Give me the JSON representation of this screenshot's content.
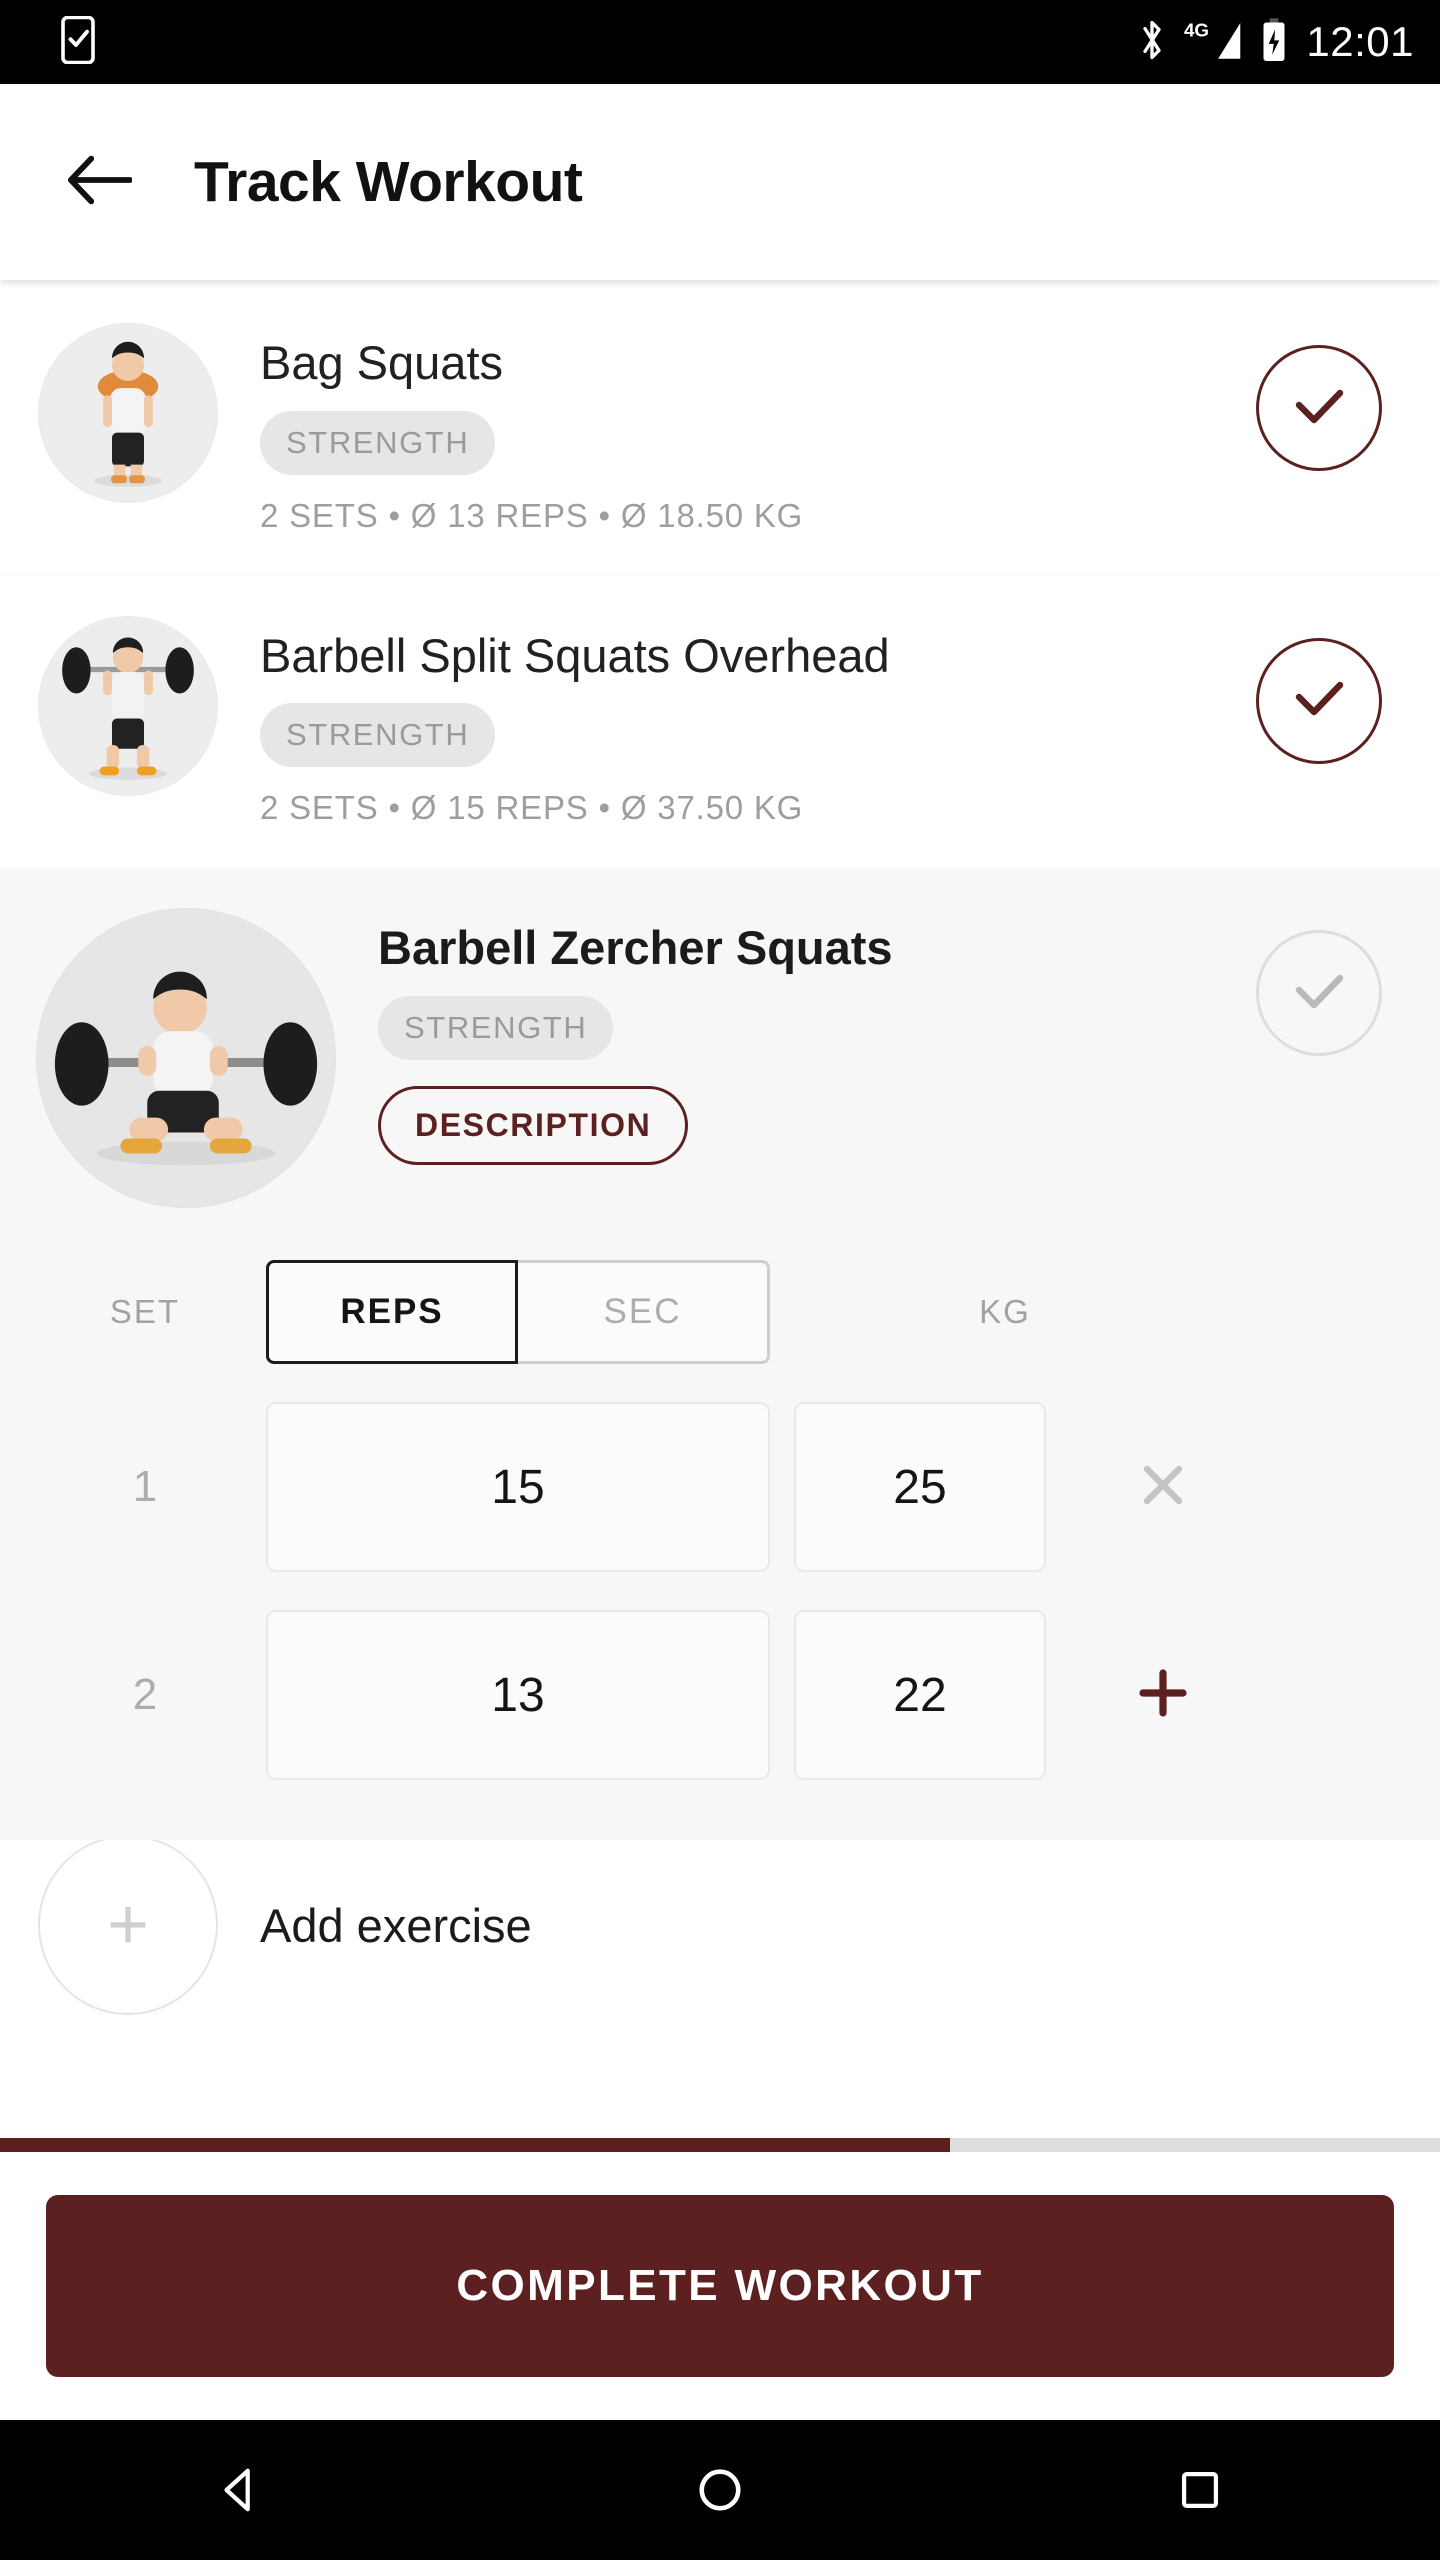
{
  "status_bar": {
    "time": "12:01",
    "icons": [
      "phone-check-icon",
      "bluetooth-icon",
      "signal-4g-icon",
      "battery-charging-icon"
    ],
    "network_label": "4G"
  },
  "app_bar": {
    "back_icon": "arrow-left-icon",
    "title": "Track Workout"
  },
  "exercises": [
    {
      "name": "Bag Squats",
      "category": "STRENGTH",
      "meta": "2 SETS • Ø 13 REPS  • Ø 18.50 KG",
      "completed": true,
      "thumb": "bag-squats-figure"
    },
    {
      "name": "Barbell Split Squats Overhead",
      "category": "STRENGTH",
      "meta": "2 SETS • Ø 15 REPS  • Ø 37.50 KG",
      "completed": true,
      "thumb": "barbell-split-squats-figure"
    }
  ],
  "expanded_exercise": {
    "name": "Barbell Zercher Squats",
    "category": "STRENGTH",
    "description_button": "DESCRIPTION",
    "completed": false,
    "thumb": "barbell-zercher-squats-figure",
    "table": {
      "col_set": "SET",
      "col_kg": "KG",
      "unit_toggle": {
        "options": [
          "REPS",
          "SEC"
        ],
        "selected": "REPS"
      },
      "rows": [
        {
          "set": "1",
          "reps": "15",
          "kg": "25",
          "action": "remove-set",
          "action_glyph": "×"
        },
        {
          "set": "2",
          "reps": "13",
          "kg": "22",
          "action": "add-set",
          "action_glyph": "+"
        }
      ]
    }
  },
  "add_exercise": {
    "label": "Add exercise",
    "icon": "plus-icon"
  },
  "progress": {
    "percent": 66
  },
  "cta": {
    "label": "COMPLETE WORKOUT"
  },
  "nav_bar": {
    "back": "nav-back-icon",
    "home": "nav-home-icon",
    "recents": "nav-recents-icon"
  },
  "colors": {
    "accent": "#5C2020",
    "background": "#FFFFFF",
    "expanded_background": "#F7F7F7",
    "badge_bg": "#E6E6E6",
    "muted_text": "#9E9E9E"
  }
}
